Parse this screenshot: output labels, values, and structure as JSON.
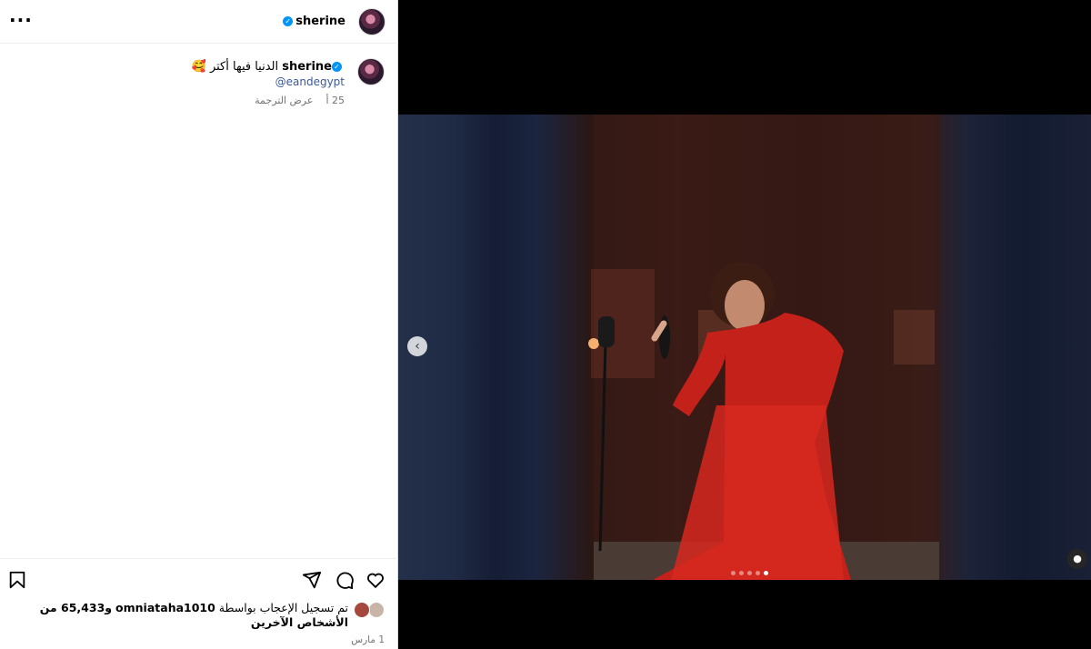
{
  "header": {
    "username": "sherine",
    "more_label": "···"
  },
  "caption": {
    "username": "sherine",
    "text": "الدنيا فيها أكتر 🥰",
    "mention": "@eandegypt",
    "age": "25 أ",
    "translate_label": "عرض الترجمة"
  },
  "likes": {
    "prefix": "تم تسجيل الإعجاب بواسطة",
    "liker": "omniataha1010",
    "others": "و65,433 من الأشخاص الآخرين"
  },
  "date": "1 مارس",
  "media": {
    "dots_count": 5,
    "active_dot": 4
  },
  "colors": {
    "verified": "#0095f6",
    "mention": "#3b5998",
    "meta": "#737373"
  },
  "icons": [
    "more-icon",
    "verified-icon",
    "heart-icon",
    "comment-icon",
    "share-icon",
    "bookmark-icon",
    "chevron-left-icon",
    "user-tag-icon"
  ]
}
